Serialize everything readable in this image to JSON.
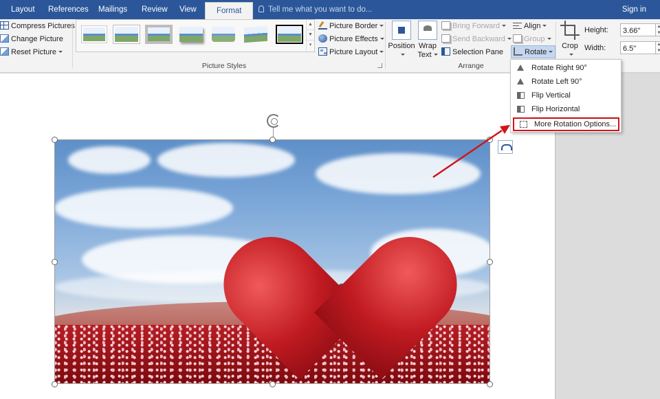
{
  "tabs": [
    "Layout",
    "References",
    "Mailings",
    "Review",
    "View",
    "Format"
  ],
  "active_tab": "Format",
  "tell_me_placeholder": "Tell me what you want to do...",
  "sign_in": "Sign in",
  "adjust": {
    "compress": "Compress Pictures",
    "change": "Change Picture",
    "reset": "Reset Picture"
  },
  "picture_styles": {
    "label": "Picture Styles",
    "border": "Picture Border",
    "effects": "Picture Effects",
    "layout": "Picture Layout"
  },
  "arrange": {
    "label": "Arrange",
    "position": "Position",
    "wrap_text_1": "Wrap",
    "wrap_text_2": "Text",
    "bring_forward": "Bring Forward",
    "send_backward": "Send Backward",
    "selection_pane": "Selection Pane",
    "align": "Align",
    "group": "Group",
    "rotate": "Rotate"
  },
  "size": {
    "crop": "Crop",
    "height_label": "Height:",
    "height_value": "3.66\"",
    "width_label": "Width:",
    "width_value": "6.5\""
  },
  "rotate_menu": {
    "items": [
      "Rotate Right 90°",
      "Rotate Left 90°",
      "Flip Vertical",
      "Flip Horizontal"
    ],
    "more": "More Rotation Options..."
  },
  "colors": {
    "ribbon_blue": "#2b579a",
    "highlight_red": "#d0141a"
  }
}
